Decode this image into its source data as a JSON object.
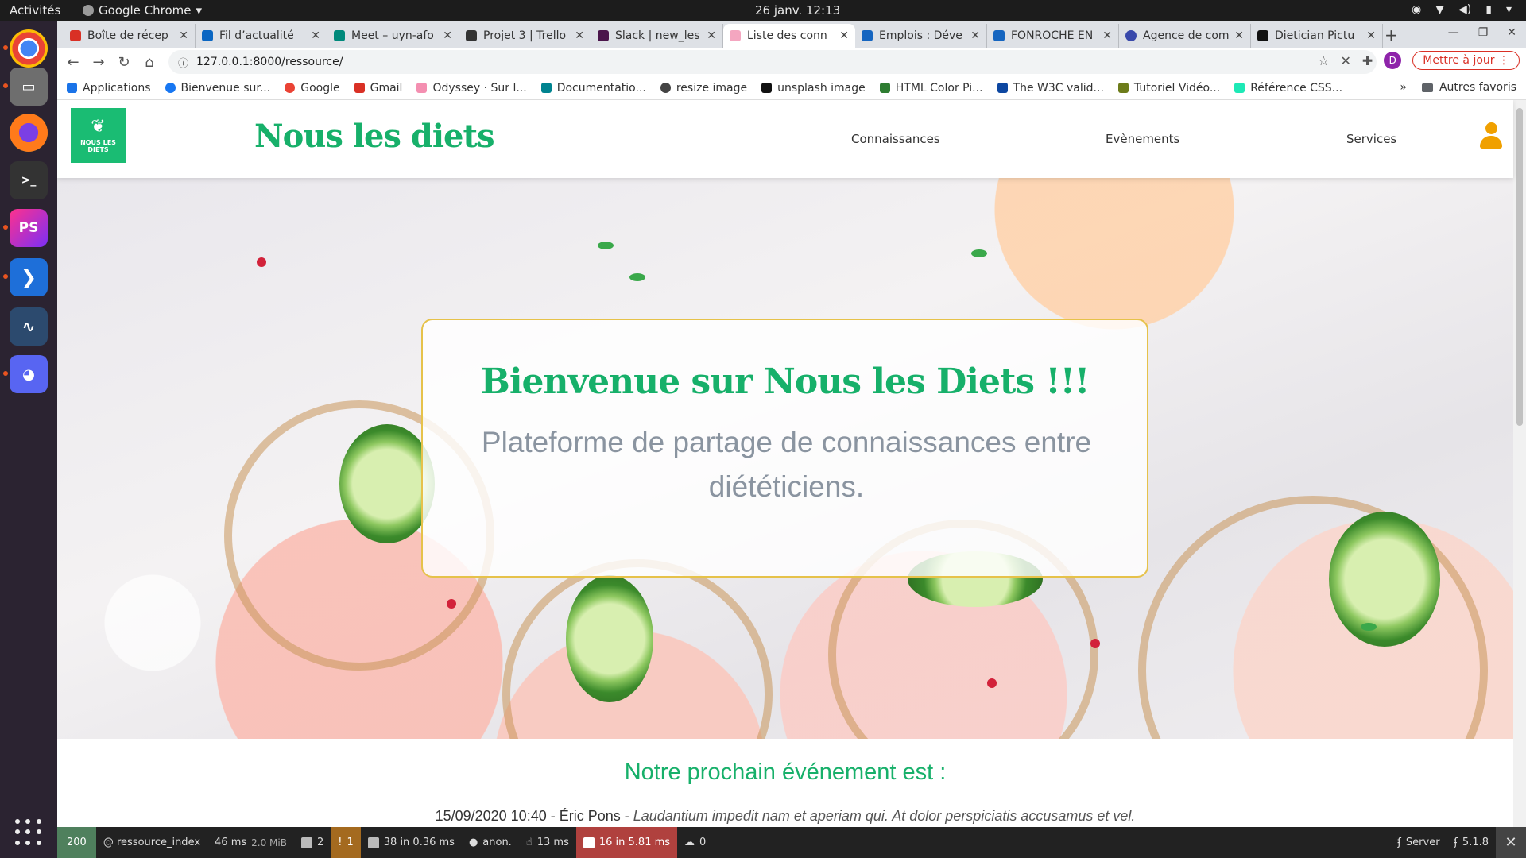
{
  "os_bar": {
    "activities": "Activités",
    "app_name": "Google Chrome",
    "clock": "26 janv.  12:13"
  },
  "dock": {
    "apps": [
      "chrome-icon",
      "files-icon",
      "firefox-icon",
      "terminal-icon",
      "phpstorm-icon",
      "vscode-icon",
      "mysql-workbench-icon",
      "discord-icon"
    ]
  },
  "tabs": [
    {
      "label": "Boîte de récep",
      "color": "#d93025"
    },
    {
      "label": "Fil d’actualité",
      "color": "#0a66c2"
    },
    {
      "label": "Meet – uyn-afo",
      "color": "#00897b"
    },
    {
      "label": "Projet 3 | Trello",
      "color": "#333333"
    },
    {
      "label": "Slack | new_les",
      "color": "#4a154b"
    },
    {
      "label": "Liste des conn",
      "color": "#f4a6c0"
    },
    {
      "label": "Emplois : Déve",
      "color": "#1565c0"
    },
    {
      "label": "FONROCHE EN",
      "color": "#1565c0"
    },
    {
      "label": "Agence de com",
      "color": "#3949ab"
    },
    {
      "label": "Dietician Pictu",
      "color": "#111111"
    }
  ],
  "toolbar": {
    "url": "127.0.0.1:8000/ressource/",
    "update_label": "Mettre à jour",
    "avatar_letter": "D"
  },
  "bookmarks": [
    {
      "label": "Applications",
      "color": "#1a73e8"
    },
    {
      "label": "Bienvenue sur...",
      "color": "#1877f2"
    },
    {
      "label": "Google",
      "color": "#ea4335"
    },
    {
      "label": "Gmail",
      "color": "#d93025"
    },
    {
      "label": "Odyssey · Sur l...",
      "color": "#f48fb1"
    },
    {
      "label": "Documentatio...",
      "color": "#00838f"
    },
    {
      "label": "resize image",
      "color": "#444444"
    },
    {
      "label": "unsplash image",
      "color": "#111111"
    },
    {
      "label": "HTML Color Pi...",
      "color": "#2e7d32"
    },
    {
      "label": "The W3C valid...",
      "color": "#0d47a1"
    },
    {
      "label": "Tutoriel Vidéo...",
      "color": "#6d7c1a"
    },
    {
      "label": "Référence CSS...",
      "color": "#1de9b6"
    }
  ],
  "bookmarks_more": "»",
  "bookmarks_other": "Autres favoris",
  "site": {
    "logo_text": "NOUS LES DIETS",
    "brand": "Nous les diets",
    "nav": [
      "Connaissances",
      "Evènements",
      "Services"
    ],
    "hero_title": "Bienvenue sur Nous les Diets !!!",
    "hero_subtitle": "Plateforme de partage de connaissances entre diététiciens.",
    "event_heading": "Notre prochain événement est :",
    "event_date": "15/09/2020 10:40 - Éric Pons -",
    "event_description": "Laudantium impedit nam et aperiam qui. At dolor perspiciatis accusamus et vel."
  },
  "debug_bar": {
    "status": "200",
    "route": "@ ressource_index",
    "time": "46 ms",
    "memory": "2.0 MiB",
    "forms": "2",
    "warnings": "1",
    "cache": "38 in 0.36 ms",
    "user": "anon.",
    "events_time": "13 ms",
    "db": "16 in 5.81 ms",
    "http": "0",
    "server": "Server",
    "version": "5.1.8"
  }
}
